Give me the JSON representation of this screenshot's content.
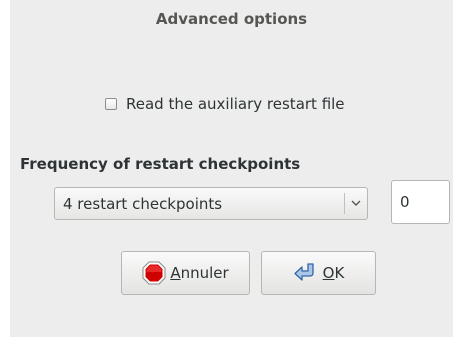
{
  "dialog": {
    "title": "Advanced options"
  },
  "restart_file": {
    "label": "Read the auxiliary restart file",
    "checked": false
  },
  "checkpoints": {
    "section_label": "Frequency of restart checkpoints",
    "selected_option": "4 restart checkpoints",
    "value": "0"
  },
  "buttons": {
    "cancel": {
      "mnemonic": "A",
      "rest": "nnuler",
      "icon": "stop-icon"
    },
    "ok": {
      "mnemonic": "O",
      "rest": "K",
      "icon": "enter-arrow-icon"
    }
  },
  "colors": {
    "dialog_background": "#ededed",
    "stop_icon_red": "#d10000"
  }
}
